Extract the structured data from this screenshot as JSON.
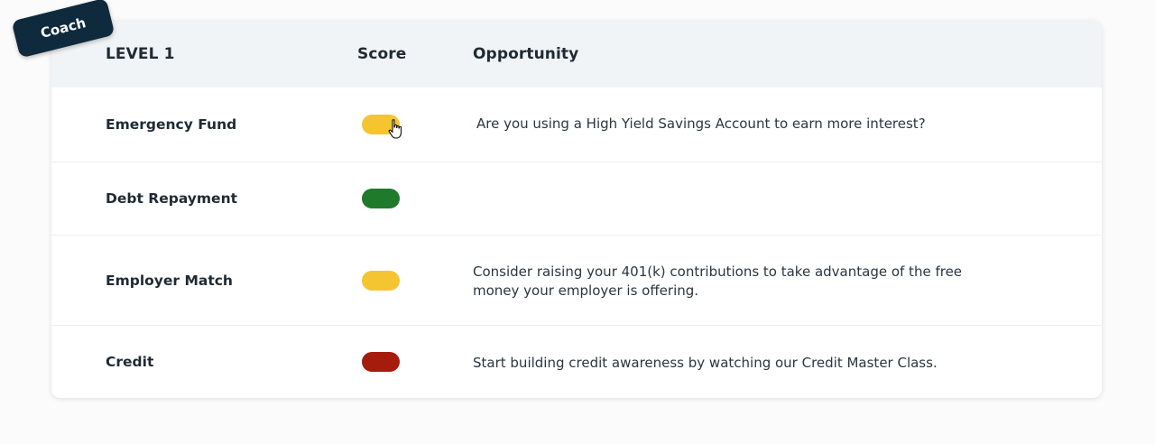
{
  "badge": {
    "label": "Coach"
  },
  "table": {
    "headers": {
      "level": "LEVEL 1",
      "score": "Score",
      "opportunity": "Opportunity"
    },
    "rows": [
      {
        "category": "Emergency Fund",
        "score_status": "yellow",
        "score_color": "#f5c531",
        "opportunity": "Are you using a High Yield Savings Account to earn more interest?"
      },
      {
        "category": "Debt Repayment",
        "score_status": "green",
        "score_color": "#1f7a2c",
        "opportunity": ""
      },
      {
        "category": "Employer Match",
        "score_status": "yellow",
        "score_color": "#f5c531",
        "opportunity": "Consider raising your 401(k) contributions to take advantage of the free money your employer is offering."
      },
      {
        "category": "Credit",
        "score_status": "red",
        "score_color": "#a51c0e",
        "opportunity": "Start building credit awareness by watching our Credit Master Class."
      }
    ]
  },
  "colors": {
    "header_bg": "#f1f4f6",
    "badge_bg": "#0e2a3c",
    "text": "#1f2a33"
  },
  "cursor": {
    "icon": "hand-pointer-icon"
  }
}
